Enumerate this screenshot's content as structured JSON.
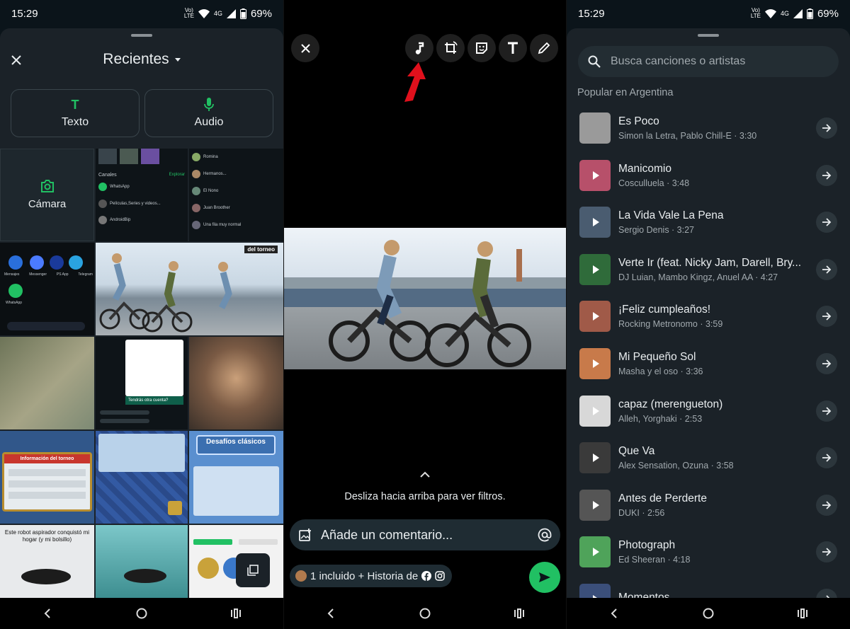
{
  "status": {
    "time": "15:29",
    "net_top": "Vo)",
    "net_bottom": "LTE",
    "gen": "4G",
    "battery": "69%"
  },
  "picker": {
    "title": "Recientes",
    "modes": [
      {
        "label": "Texto"
      },
      {
        "label": "Audio"
      }
    ],
    "camera_label": "Cámara",
    "chat_tile": {
      "channels": "Canales",
      "explore": "Explorar",
      "rows": [
        "WhatsApp",
        "Películas,Series y videos...",
        "AndroidBip",
        "Romina",
        "Hermanos...",
        "El Nono",
        "Juan Broother",
        "Una fila muy normal"
      ]
    },
    "apps_tile": [
      "Mensajes",
      "Messenger",
      "PS App",
      "Telegram",
      "WhatsApp"
    ],
    "torneo_banner": "del torneo",
    "dialog_text": "Tendrás otra cuenta?",
    "tournament_tile": "Información del torneo",
    "challenge_tile": "Desafíos clásicos",
    "robot_tile": "Este robot aspirador conquistó mi hogar (y mi bolsillo)"
  },
  "editor": {
    "swipe_hint": "Desliza hacia arriba para ver filtros.",
    "comment_placeholder": "Añade un comentario...",
    "audience": "1 incluido + Historia de",
    "tools": [
      "music-icon",
      "crop-rotate-icon",
      "sticker-icon",
      "text-icon",
      "pencil-icon"
    ]
  },
  "music": {
    "search_placeholder": "Busca canciones o artistas",
    "section": "Popular en Argentina",
    "songs": [
      {
        "title": "Es Poco",
        "subtitle": "Simon la Letra, Pablo Chill-E · 3:30",
        "color": "#9a9a9a"
      },
      {
        "title": "Manicomio",
        "subtitle": "Cosculluela · 3:48",
        "color": "#b7506a"
      },
      {
        "title": "La Vida Vale La Pena",
        "subtitle": "Sergio Denis · 3:27",
        "color": "#4a5c70"
      },
      {
        "title": "Verte Ir (feat. Nicky Jam, Darell, Bry...",
        "subtitle": "DJ Luian, Mambo Kingz, Anuel AA · 4:27",
        "color": "#2f6b3a"
      },
      {
        "title": "¡Feliz cumpleaños!",
        "subtitle": "Rocking Metronomo · 3:59",
        "color": "#a05a48"
      },
      {
        "title": "Mi Pequeño Sol",
        "subtitle": "Masha y el oso · 3:36",
        "color": "#c87a4a"
      },
      {
        "title": "capaz (merengueton)",
        "subtitle": "Alleh, Yorghaki · 2:53",
        "color": "#d8d8d8"
      },
      {
        "title": "Que Va",
        "subtitle": "Alex Sensation, Ozuna · 3:58",
        "color": "#3a3a3a"
      },
      {
        "title": "Antes de Perderte",
        "subtitle": "DUKI · 2:56",
        "color": "#555555"
      },
      {
        "title": "Photograph",
        "subtitle": "Ed Sheeran · 4:18",
        "color": "#4fa35a"
      },
      {
        "title": "Momentos",
        "subtitle": "",
        "color": "#3b4f7a"
      }
    ]
  },
  "colors": {
    "accent": "#21c063",
    "sheet": "#1b2228",
    "surface": "#1f2c33",
    "arrow": "#e0101c"
  }
}
